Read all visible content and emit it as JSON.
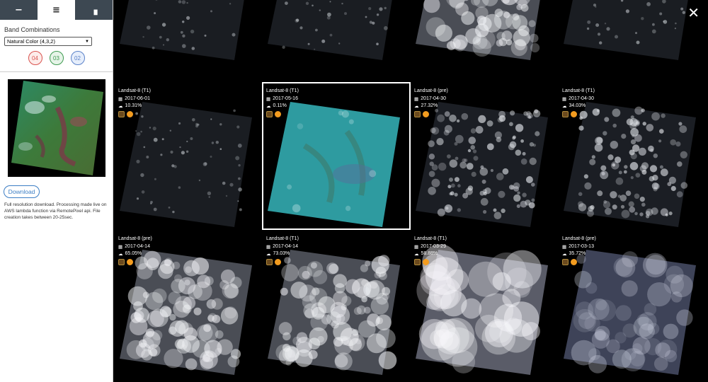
{
  "sidebar": {
    "tabs": [
      {
        "label": "minus",
        "glyph": "−"
      },
      {
        "label": "menu",
        "glyph": "≡"
      },
      {
        "label": "grid",
        "glyph": "▗"
      }
    ],
    "band_title": "Band Combinations",
    "band_select": {
      "value": "Natural Color (4,3,2)"
    },
    "bands": [
      "04",
      "03",
      "02"
    ],
    "download_label": "Download",
    "download_note": "Full resolution download. Processing made live on AWS lambda function via RemotePixel api. File creation takes between 20-25sec."
  },
  "close_icon_glyph": "✕",
  "scenes": [
    {
      "satellite": "",
      "date": "",
      "cloud": "",
      "style": "sparse",
      "show_info": false
    },
    {
      "satellite": "",
      "date": "",
      "cloud": "",
      "style": "sparse",
      "show_info": false
    },
    {
      "satellite": "",
      "date": "",
      "cloud": "",
      "style": "cloud",
      "show_info": false
    },
    {
      "satellite": "",
      "date": "",
      "cloud": "",
      "style": "sparse",
      "show_info": false
    },
    {
      "satellite": "Landsat-8 (T1)",
      "date": "2017-06-01",
      "cloud": "10.31%",
      "style": "sparse",
      "show_info": true
    },
    {
      "satellite": "Landsat-8 (T1)",
      "date": "2017-05-16",
      "cloud": "0.11%",
      "style": "clear",
      "show_info": true,
      "selected": true
    },
    {
      "satellite": "Landsat-8 (pre)",
      "date": "2017-04-30",
      "cloud": "27.32%",
      "style": "dense",
      "show_info": true
    },
    {
      "satellite": "Landsat-8 (T1)",
      "date": "2017-04-30",
      "cloud": "34.03%",
      "style": "dense",
      "show_info": true
    },
    {
      "satellite": "Landsat-8 (pre)",
      "date": "2017-04-14",
      "cloud": "65.05%",
      "style": "cloud",
      "show_info": true
    },
    {
      "satellite": "Landsat-8 (T1)",
      "date": "2017-04-14",
      "cloud": "73.03%",
      "style": "cloud",
      "show_info": true
    },
    {
      "satellite": "Landsat-8 (T1)",
      "date": "2017-03-29",
      "cloud": "58.88%",
      "style": "bright",
      "show_info": true
    },
    {
      "satellite": "Landsat-8 (pre)",
      "date": "2017-03-13",
      "cloud": "35.72%",
      "style": "haze",
      "show_info": true
    }
  ]
}
